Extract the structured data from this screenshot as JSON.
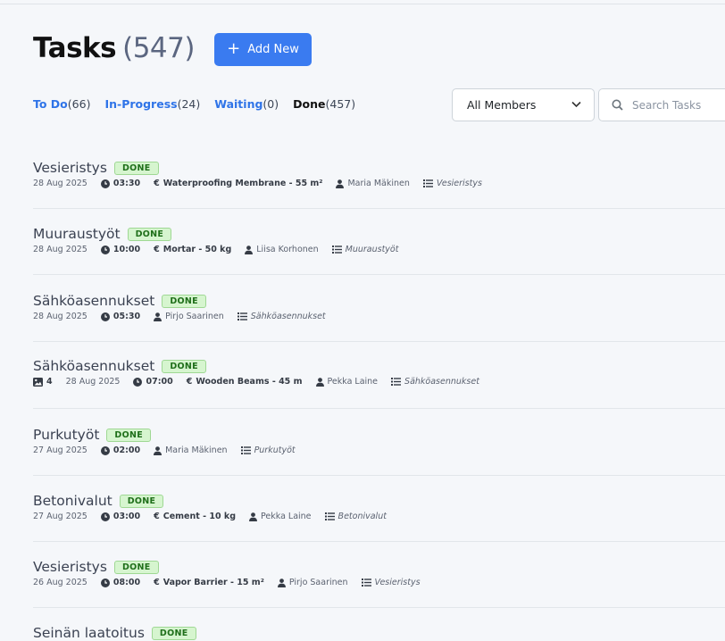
{
  "header": {
    "title": "Tasks",
    "count": "(547)",
    "add_button_label": "Add New"
  },
  "filters": [
    {
      "label": "To Do",
      "count": "(66)"
    },
    {
      "label": "In-Progress",
      "count": "(24)"
    },
    {
      "label": "Waiting",
      "count": "(0)"
    },
    {
      "label": "Done",
      "count": "(457)"
    }
  ],
  "members_select": {
    "selected": "All Members"
  },
  "search": {
    "placeholder": "Search Tasks",
    "value": ""
  },
  "colors": {
    "accent": "#3a7bf0",
    "done_badge_bg": "#d6f5cf",
    "done_badge_text": "#1f6f1a"
  },
  "tasks": [
    {
      "title": "Vesieristys",
      "status": "DONE",
      "date": "28 Aug 2025",
      "time": "03:30",
      "material": "Waterproofing Membrane - 55 m²",
      "assignee": "Maria Mäkinen",
      "category": "Vesieristys"
    },
    {
      "title": "Muuraustyöt",
      "status": "DONE",
      "date": "28 Aug 2025",
      "time": "10:00",
      "material": "Mortar - 50 kg",
      "assignee": "Liisa Korhonen",
      "category": "Muuraustyöt"
    },
    {
      "title": "Sähköasennukset",
      "status": "DONE",
      "date": "28 Aug 2025",
      "time": "05:30",
      "assignee": "Pirjo Saarinen",
      "category": "Sähköasennukset"
    },
    {
      "title": "Sähköasennukset",
      "status": "DONE",
      "images": "4",
      "date": "28 Aug 2025",
      "time": "07:00",
      "material": "Wooden Beams - 45 m",
      "assignee": "Pekka Laine",
      "category": "Sähköasennukset"
    },
    {
      "title": "Purkutyöt",
      "status": "DONE",
      "date": "27 Aug 2025",
      "time": "02:00",
      "assignee": "Maria Mäkinen",
      "category": "Purkutyöt"
    },
    {
      "title": "Betonivalut",
      "status": "DONE",
      "date": "27 Aug 2025",
      "time": "03:00",
      "material": "Cement - 10 kg",
      "assignee": "Pekka Laine",
      "category": "Betonivalut"
    },
    {
      "title": "Vesieristys",
      "status": "DONE",
      "date": "26 Aug 2025",
      "time": "08:00",
      "material": "Vapor Barrier - 15 m²",
      "assignee": "Pirjo Saarinen",
      "category": "Vesieristys"
    },
    {
      "title": "Seinän laatoitus",
      "status": "DONE"
    }
  ]
}
